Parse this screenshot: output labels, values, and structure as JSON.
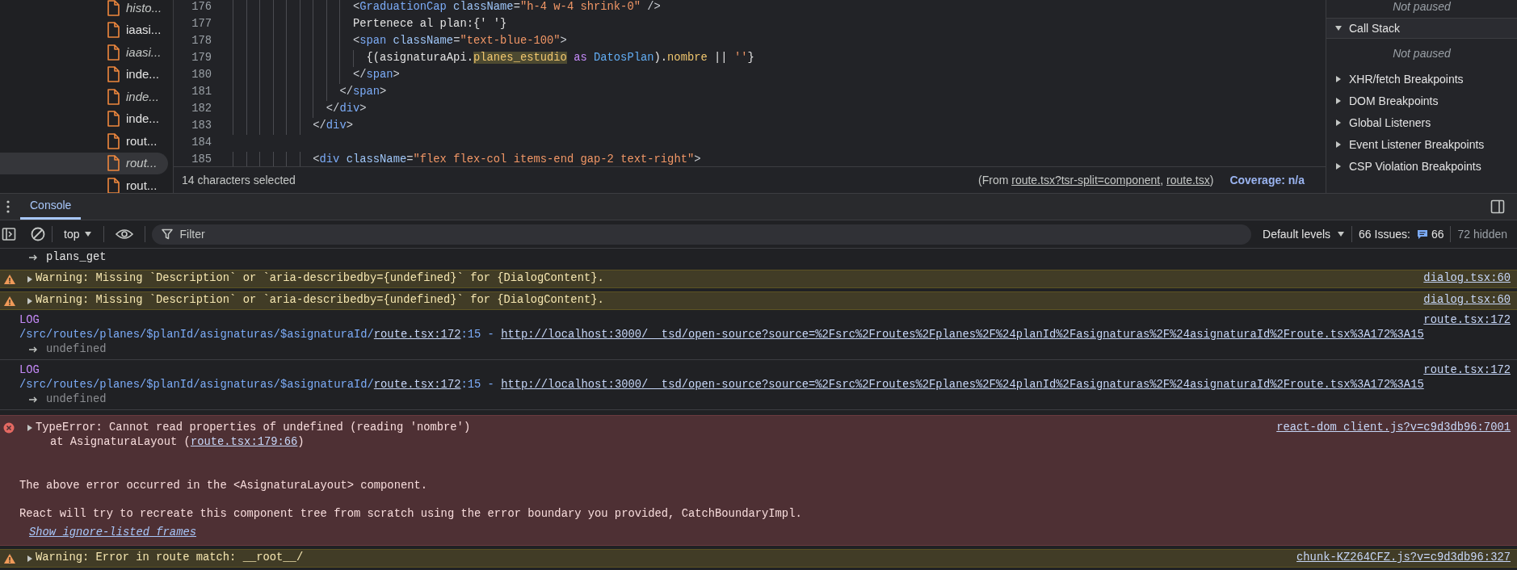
{
  "file_tree": {
    "items": [
      {
        "label": "histo...",
        "italic": true,
        "selected": false
      },
      {
        "label": "iaasi...",
        "italic": false,
        "selected": false
      },
      {
        "label": "iaasi...",
        "italic": true,
        "selected": false
      },
      {
        "label": "inde...",
        "italic": false,
        "selected": false
      },
      {
        "label": "inde...",
        "italic": true,
        "selected": false
      },
      {
        "label": "inde...",
        "italic": false,
        "selected": false
      },
      {
        "label": "rout...",
        "italic": false,
        "selected": false
      },
      {
        "label": "rout...",
        "italic": true,
        "selected": true
      },
      {
        "label": "rout...",
        "italic": false,
        "selected": false
      }
    ]
  },
  "editor": {
    "lines": [
      {
        "number": "176",
        "tokens": [
          {
            "text": "                  <",
            "kind": "punct"
          },
          {
            "text": "GraduationCap",
            "kind": "tag"
          },
          {
            "text": " className",
            "kind": "attr"
          },
          {
            "text": "=",
            "kind": "punct"
          },
          {
            "text": "\"h-4 w-4 shrink-0\"",
            "kind": "string"
          },
          {
            "text": " />",
            "kind": "punct"
          }
        ]
      },
      {
        "number": "177",
        "tokens": [
          {
            "text": "                  Pertenece al plan:{' '}",
            "kind": "text"
          }
        ]
      },
      {
        "number": "178",
        "tokens": [
          {
            "text": "                  <",
            "kind": "punct"
          },
          {
            "text": "span",
            "kind": "tag"
          },
          {
            "text": " className",
            "kind": "attr"
          },
          {
            "text": "=",
            "kind": "punct"
          },
          {
            "text": "\"text-blue-100\"",
            "kind": "string"
          },
          {
            "text": ">",
            "kind": "punct"
          }
        ]
      },
      {
        "number": "179",
        "tokens": [
          {
            "text": "                    {(asignaturaApi.",
            "kind": "text"
          },
          {
            "text": "planes_estudio",
            "kind": "selected"
          },
          {
            "text": " as",
            "kind": "keyword"
          },
          {
            "text": " DatosPlan",
            "kind": "type"
          },
          {
            "text": ").",
            "kind": "text"
          },
          {
            "text": "nombre",
            "kind": "prop"
          },
          {
            "text": " || ",
            "kind": "text"
          },
          {
            "text": "''",
            "kind": "string"
          },
          {
            "text": "}",
            "kind": "text"
          }
        ]
      },
      {
        "number": "180",
        "tokens": [
          {
            "text": "                  </",
            "kind": "punct"
          },
          {
            "text": "span",
            "kind": "tag"
          },
          {
            "text": ">",
            "kind": "punct"
          }
        ]
      },
      {
        "number": "181",
        "tokens": [
          {
            "text": "                </",
            "kind": "punct"
          },
          {
            "text": "span",
            "kind": "tag"
          },
          {
            "text": ">",
            "kind": "punct"
          }
        ]
      },
      {
        "number": "182",
        "tokens": [
          {
            "text": "              </",
            "kind": "punct"
          },
          {
            "text": "div",
            "kind": "tag"
          },
          {
            "text": ">",
            "kind": "punct"
          }
        ]
      },
      {
        "number": "183",
        "tokens": [
          {
            "text": "            </",
            "kind": "punct"
          },
          {
            "text": "div",
            "kind": "tag"
          },
          {
            "text": ">",
            "kind": "punct"
          }
        ]
      },
      {
        "number": "184"
      },
      {
        "number": "185",
        "tokens": [
          {
            "text": "            <",
            "kind": "punct"
          },
          {
            "text": "div",
            "kind": "tag"
          },
          {
            "text": " className",
            "kind": "attr"
          },
          {
            "text": "=",
            "kind": "punct"
          },
          {
            "text": "\"flex flex-col items-end gap-2 text-right\"",
            "kind": "string"
          },
          {
            "text": ">",
            "kind": "punct"
          }
        ]
      }
    ],
    "status": {
      "selection": "14 characters selected",
      "source_parts": [
        {
          "text": "(From ",
          "link": false
        },
        {
          "text": "route.tsx?tsr-split=component",
          "link": true
        },
        {
          "text": ", ",
          "link": false
        },
        {
          "text": "route.tsx",
          "link": true
        },
        {
          "text": ")",
          "link": false
        }
      ],
      "coverage": "Coverage: n/a"
    }
  },
  "debugger": {
    "top_note": "Not paused",
    "sections": [
      {
        "title": "Call Stack",
        "expanded": true,
        "body": "Not paused"
      },
      {
        "title": "XHR/fetch Breakpoints",
        "expanded": false
      },
      {
        "title": "DOM Breakpoints",
        "expanded": false
      },
      {
        "title": "Global Listeners",
        "expanded": false
      },
      {
        "title": "Event Listener Breakpoints",
        "expanded": false
      },
      {
        "title": "CSP Violation Breakpoints",
        "expanded": false
      }
    ]
  },
  "drawer": {
    "tabs": [
      {
        "label": "Console",
        "selected": true
      }
    ]
  },
  "console_toolbar": {
    "context": "top",
    "filter_placeholder": "Filter",
    "levels": "Default levels",
    "issues_label": "66 Issues:",
    "issues_count": "66",
    "hidden": "72 hidden"
  },
  "messages": [
    {
      "kind": "continuation",
      "text": "plans_get"
    },
    {
      "kind": "warning",
      "expanded": false,
      "text": "Warning: Missing `Description` or `aria-describedby={undefined}` for {DialogContent}.",
      "source": "dialog.tsx:60"
    },
    {
      "kind": "warning",
      "expanded": false,
      "text": "Warning: Missing `Description` or `aria-describedby={undefined}` for {DialogContent}.",
      "source": "dialog.tsx:60"
    },
    {
      "kind": "log",
      "label": "LOG",
      "path": "/src/routes/planes/$planId/asignaturas/$asignaturaId/",
      "file_link": "route.tsx:172",
      "middle": ":15 - ",
      "url": "http://localhost:3000/__tsd/open-source?source=%2Fsrc%2Froutes%2Fplanes%2F%24planId%2Fasignaturas%2F%24asignaturaId%2Froute.tsx%3A172%3A15",
      "result": "undefined",
      "source": "route.tsx:172"
    },
    {
      "kind": "log",
      "label": "LOG",
      "path": "/src/routes/planes/$planId/asignaturas/$asignaturaId/",
      "file_link": "route.tsx:172",
      "middle": ":15 - ",
      "url": "http://localhost:3000/__tsd/open-source?source=%2Fsrc%2Froutes%2Fplanes%2F%24planId%2Fasignaturas%2F%24asignaturaId%2Froute.tsx%3A172%3A15",
      "result": "undefined",
      "source": "route.tsx:172"
    },
    {
      "kind": "error",
      "expanded": false,
      "text": "TypeError: Cannot read properties of undefined (reading 'nombre')",
      "stack_prefix": "at AsignaturaLayout (",
      "stack_link": "route.tsx:179:66",
      "stack_suffix": ")",
      "notes": [
        "The above error occurred in the <AsignaturaLayout> component.",
        "React will try to recreate this component tree from scratch using the error boundary you provided, CatchBoundaryImpl."
      ],
      "ignore_link": "Show ignore-listed frames",
      "source": "react-dom_client.js?v=c9d3db96:7001"
    },
    {
      "kind": "warning",
      "expanded": false,
      "text": "Warning: Error in route match: __root__/",
      "source": "chunk-KZ264CFZ.js?v=c9d3db96:327"
    }
  ]
}
